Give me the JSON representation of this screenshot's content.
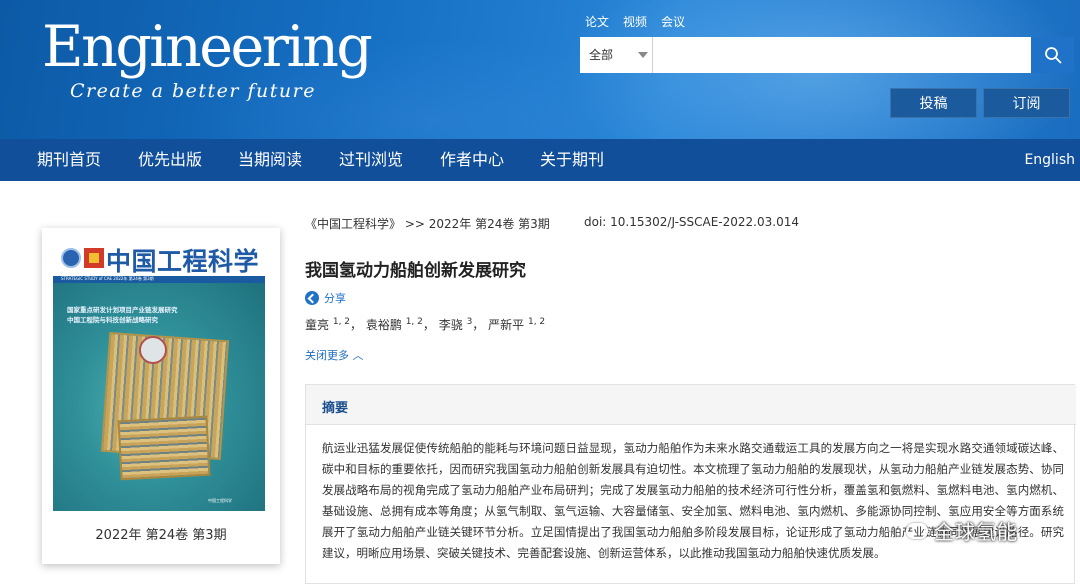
{
  "brand": {
    "name": "Engineering",
    "tagline": "Create a better future"
  },
  "top_links": [
    "论文",
    "视频",
    "会议"
  ],
  "search": {
    "scope_value": "全部",
    "placeholder": ""
  },
  "header_buttons": {
    "submit": "投稿",
    "subscribe": "订阅"
  },
  "nav": {
    "items": [
      "期刊首页",
      "优先出版",
      "当期阅读",
      "过刊浏览",
      "作者中心",
      "关于期刊"
    ],
    "language": "English"
  },
  "cover": {
    "journal_name": "中国工程科学",
    "band_text": "STRATEGIC STUDY of CAE   2022年 第24卷 第3期",
    "headline_1": "国家重点研发计划项目产业链发展研究",
    "headline_2": "中国工程院与科技创新战略研究",
    "footer_text": "中国工程科学",
    "issue": "2022年 第24卷 第3期"
  },
  "article": {
    "breadcrumb": "《中国工程科学》 >> 2022年 第24卷 第3期",
    "doi": "doi: 10.15302/J-SSCAE-2022.03.014",
    "title": "我国氢动力船舶创新发展研究",
    "share_label": "分享",
    "authors": [
      {
        "name": "童亮",
        "aff": "1, 2"
      },
      {
        "name": "袁裕鹏",
        "aff": "1, 2"
      },
      {
        "name": "李骁",
        "aff": "3"
      },
      {
        "name": "严新平",
        "aff": "1, 2"
      }
    ],
    "collapse_label": "关闭更多",
    "abstract_heading": "摘要",
    "abstract": "航运业迅猛发展促使传统船舶的能耗与环境问题日益显现，氢动力船舶作为未来水路交通载运工具的发展方向之一将是实现水路交通领域碳达峰、碳中和目标的重要依托，因而研究我国氢动力船舶创新发展具有迫切性。本文梳理了氢动力船舶的发展现状，从氢动力船舶产业链发展态势、协同发展战略布局的视角完成了氢动力船舶产业布局研判；完成了发展氢动力船舶的技术经济可行性分析，覆盖氢和氨燃料、氢燃料电池、氢内燃机、基础设施、总拥有成本等角度；从氢气制取、氢气运输、大容量储氢、安全加氢、燃料电池、氢内燃机、多能源协同控制、氢应用安全等方面系统展开了氢动力船舶产业链关键环节分析。立足国情提出了我国氢动力船舶多阶段发展目标，论证形成了氢动力船舶产业链协同发展建设路径。研究建议，明晰应用场景、突破关键技术、完善配套设施、创新运营体系，以此推动我国氢动力船舶快速优质发展。"
  },
  "watermark": "全球氢能",
  "colors": {
    "header_blue": "#1670c4",
    "nav_blue": "#114f9b",
    "link_blue": "#1f72c8",
    "button_blue": "#1b5a9c"
  },
  "icons": [
    "search-icon",
    "share-icon",
    "chevron-up-icon",
    "wechat-icon"
  ]
}
